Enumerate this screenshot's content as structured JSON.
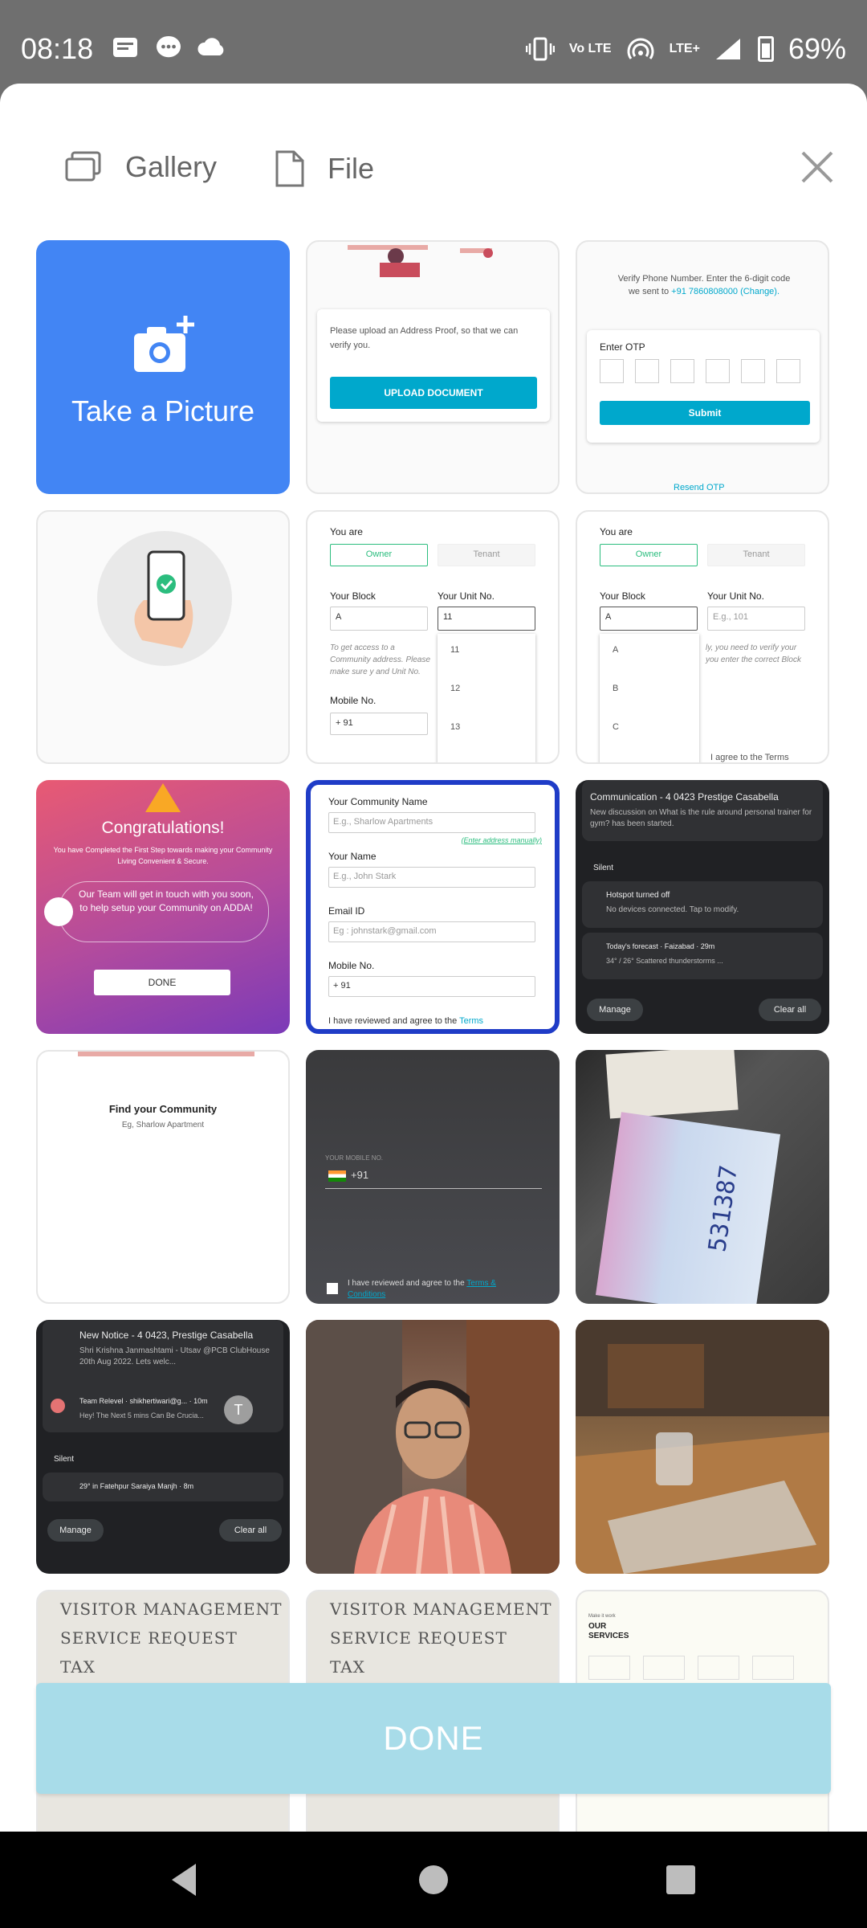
{
  "status": {
    "time": "08:18",
    "battery": "69%",
    "network_label": "LTE+",
    "volte_label": "Vo LTE"
  },
  "picker": {
    "tabs": [
      {
        "label": "Gallery",
        "icon": "gallery-icon"
      },
      {
        "label": "File",
        "icon": "file-icon"
      }
    ],
    "close_icon": "close-icon"
  },
  "tiles": {
    "take_picture": "Take a Picture",
    "t1": {
      "text": "Please upload an Address Proof, so that we can verify you.",
      "button": "UPLOAD DOCUMENT"
    },
    "t2": {
      "text1": "Verify Phone Number. Enter the 6-digit code",
      "text2": "we sent to",
      "phone": "+91 7860808000 (Change).",
      "otp_label": "Enter OTP",
      "button": "Submit",
      "resend": "Resend OTP"
    },
    "t4": {
      "you_are": "You are",
      "owner": "Owner",
      "tenant": "Tenant",
      "block": "Your Block",
      "unit": "Your Unit No.",
      "block_val": "A",
      "unit_val": "11",
      "hint": "To get access to a Community address. Please make sure y and Unit No.",
      "mobile": "Mobile No.",
      "code": "+ 91",
      "options": [
        "11",
        "12",
        "13"
      ]
    },
    "t5": {
      "you_are": "You are",
      "owner": "Owner",
      "tenant": "Tenant",
      "block": "Your Block",
      "unit": "Your Unit No.",
      "block_val": "A",
      "unit_ph": "E.g., 101",
      "hint": "ly, you need to verify your you enter the correct Block",
      "options": [
        "A",
        "B",
        "C"
      ],
      "agree": "I agree to the Terms"
    },
    "t6": {
      "title": "Congratulations!",
      "sub": "You have Completed the First Step towards making your Community Living Convenient & Secure.",
      "msg": "Our Team will get in touch with you soon, to help setup your Community on ADDA!",
      "button": "DONE"
    },
    "t7": {
      "l1": "Your Community Name",
      "p1": "E.g., Sharlow Apartments",
      "link": "(Enter address manually)",
      "l2": "Your Name",
      "p2": "E.g., John Stark",
      "l3": "Email ID",
      "p3": "Eg : johnstark@gmail.com",
      "l4": "Mobile No.",
      "code": "+ 91",
      "agree": "I have reviewed and agree to the",
      "terms": "Terms"
    },
    "t8": {
      "n1_title": "Communication - 4 0423 Prestige Casabella",
      "n1_body": "New discussion on What is the rule around personal trainer for gym? has been started.",
      "silent": "Silent",
      "n2_title": "Hotspot turned off",
      "n2_body": "No devices connected. Tap to modify.",
      "n3_title": "Today's forecast · Faizabad · 29m",
      "n3_body": "34° / 26°  Scattered thunderstorms ...",
      "manage": "Manage",
      "clear": "Clear all"
    },
    "t9": {
      "title": "Find your Community",
      "sub": "Eg, Sharlow Apartment"
    },
    "t10": {
      "label": "YOUR MOBILE NO.",
      "code": "+91",
      "agree": "I have reviewed and agree to the",
      "terms": "Terms & Conditions"
    },
    "t11": {
      "numbers": "531387"
    },
    "t12": {
      "n1_title": "New Notice - 4 0423, Prestige Casabella",
      "n1_body": "Shri Krishna Janmashtami - Utsav @PCB ClubHouse 20th Aug 2022. Lets welc...",
      "n2_title": "Team Relevel · shikhertiwari@g... · 10m",
      "n2_body": "Hey! The Next 5 mins Can Be Crucia...",
      "avatar": "T",
      "silent": "Silent",
      "n3": "29° in Fatehpur Saraiya Manjh · 8m",
      "manage": "Manage",
      "clear": "Clear all"
    },
    "t15": {
      "l1": "VISITOR MANAGEMENT",
      "l2": "SERVICE REQUEST",
      "l3": "TAX"
    },
    "t16": {
      "l1": "VISITOR MANAGEMENT",
      "l2": "SERVICE REQUEST",
      "l3": "TAX"
    },
    "t17": {
      "small": "Make it work",
      "title1": "OUR",
      "title2": "SERVICES"
    }
  },
  "done_button": "DONE",
  "nav": {
    "back": "back-icon",
    "home": "home-icon",
    "recents": "recents-icon"
  }
}
